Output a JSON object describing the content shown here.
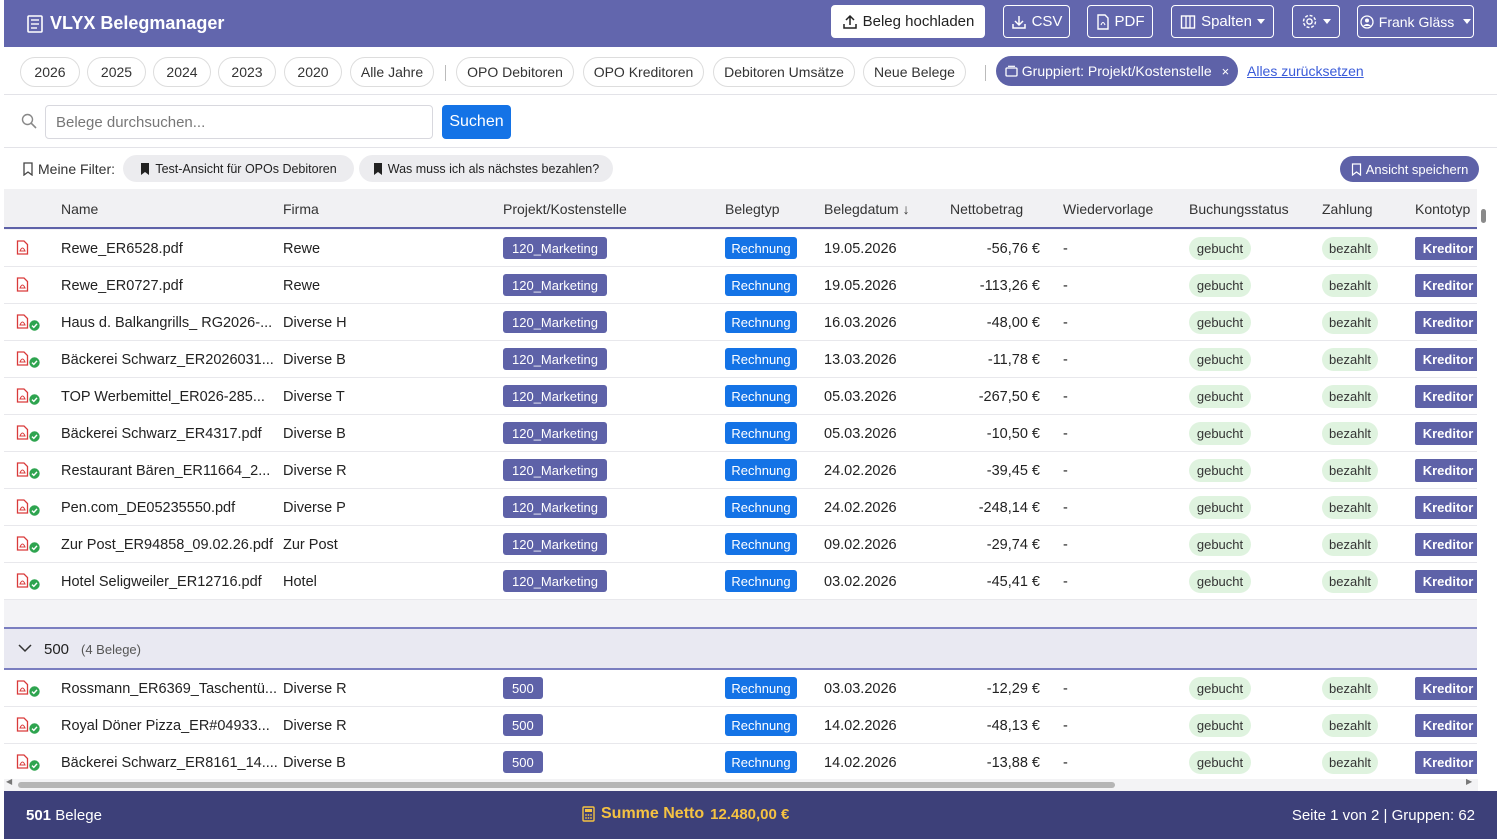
{
  "app": {
    "title": "VLYX Belegmanager"
  },
  "toolbar": {
    "upload": "Beleg hochladen",
    "csv": "CSV",
    "pdf": "PDF",
    "columns": "Spalten",
    "user": "Frank Gläss"
  },
  "chips": {
    "years": [
      "2026",
      "2025",
      "2024",
      "2023",
      "2020",
      "Alle Jahre"
    ],
    "views": [
      "OPO Debitoren",
      "OPO Kreditoren",
      "Debitoren Umsätze",
      "Neue Belege"
    ],
    "grouped": "Gruppiert: Projekt/Kostenstelle",
    "reset": "Alles zurücksetzen"
  },
  "search": {
    "placeholder": "Belege durchsuchen...",
    "button": "Suchen"
  },
  "filters": {
    "label": "Meine Filter:",
    "saved": [
      "Test-Ansicht für OPOs Debitoren",
      "Was muss ich als nächstes bezahlen?"
    ],
    "save_view": "Ansicht speichern"
  },
  "table": {
    "columns": [
      "Name",
      "Firma",
      "Projekt/Kostenstelle",
      "Belegtyp",
      "Belegdatum ↓",
      "Nettobetrag",
      "Wiedervorlage",
      "Buchungsstatus",
      "Zahlung",
      "Kontotyp"
    ],
    "rows": [
      {
        "name": "Rewe_ER6528.pdf",
        "firma": "Rewe",
        "projekt": "120_Marketing",
        "typ": "Rechnung",
        "datum": "19.05.2026",
        "netto": "-56,76 €",
        "wv": "-",
        "status": "gebucht",
        "zahlung": "bezahlt",
        "konto": "Kreditor",
        "ok": false
      },
      {
        "name": "Rewe_ER0727.pdf",
        "firma": "Rewe",
        "projekt": "120_Marketing",
        "typ": "Rechnung",
        "datum": "19.05.2026",
        "netto": "-113,26 €",
        "wv": "-",
        "status": "gebucht",
        "zahlung": "bezahlt",
        "konto": "Kreditor",
        "ok": false
      },
      {
        "name": "Haus d. Balkangrills_ RG2026-...",
        "firma": "Diverse H",
        "projekt": "120_Marketing",
        "typ": "Rechnung",
        "datum": "16.03.2026",
        "netto": "-48,00 €",
        "wv": "-",
        "status": "gebucht",
        "zahlung": "bezahlt",
        "konto": "Kreditor",
        "ok": true
      },
      {
        "name": "Bäckerei Schwarz_ER2026031...",
        "firma": "Diverse B",
        "projekt": "120_Marketing",
        "typ": "Rechnung",
        "datum": "13.03.2026",
        "netto": "-11,78 €",
        "wv": "-",
        "status": "gebucht",
        "zahlung": "bezahlt",
        "konto": "Kreditor",
        "ok": true
      },
      {
        "name": "TOP Werbemittel_ER026-285...",
        "firma": "Diverse T",
        "projekt": "120_Marketing",
        "typ": "Rechnung",
        "datum": "05.03.2026",
        "netto": "-267,50 €",
        "wv": "-",
        "status": "gebucht",
        "zahlung": "bezahlt",
        "konto": "Kreditor",
        "ok": true
      },
      {
        "name": "Bäckerei Schwarz_ER4317.pdf",
        "firma": "Diverse B",
        "projekt": "120_Marketing",
        "typ": "Rechnung",
        "datum": "05.03.2026",
        "netto": "-10,50 €",
        "wv": "-",
        "status": "gebucht",
        "zahlung": "bezahlt",
        "konto": "Kreditor",
        "ok": true
      },
      {
        "name": "Restaurant Bären_ER11664_2...",
        "firma": "Diverse R",
        "projekt": "120_Marketing",
        "typ": "Rechnung",
        "datum": "24.02.2026",
        "netto": "-39,45 €",
        "wv": "-",
        "status": "gebucht",
        "zahlung": "bezahlt",
        "konto": "Kreditor",
        "ok": true
      },
      {
        "name": "Pen.com_DE05235550.pdf",
        "firma": "Diverse P",
        "projekt": "120_Marketing",
        "typ": "Rechnung",
        "datum": "24.02.2026",
        "netto": "-248,14 €",
        "wv": "-",
        "status": "gebucht",
        "zahlung": "bezahlt",
        "konto": "Kreditor",
        "ok": true
      },
      {
        "name": "Zur Post_ER94858_09.02.26.pdf",
        "firma": "Zur Post",
        "projekt": "120_Marketing",
        "typ": "Rechnung",
        "datum": "09.02.2026",
        "netto": "-29,74 €",
        "wv": "-",
        "status": "gebucht",
        "zahlung": "bezahlt",
        "konto": "Kreditor",
        "ok": true
      },
      {
        "name": "Hotel Seligweiler_ER12716.pdf",
        "firma": "Hotel",
        "projekt": "120_Marketing",
        "typ": "Rechnung",
        "datum": "03.02.2026",
        "netto": "-45,41 €",
        "wv": "-",
        "status": "gebucht",
        "zahlung": "bezahlt",
        "konto": "Kreditor",
        "ok": true
      }
    ],
    "group": {
      "title": "500",
      "count": "(4 Belege)"
    },
    "group_rows": [
      {
        "name": "Rossmann_ER6369_Taschentü...",
        "firma": "Diverse R",
        "projekt": "500",
        "typ": "Rechnung",
        "datum": "03.03.2026",
        "netto": "-12,29 €",
        "wv": "-",
        "status": "gebucht",
        "zahlung": "bezahlt",
        "konto": "Kreditor",
        "ok": true
      },
      {
        "name": "Royal Döner Pizza_ER#04933...",
        "firma": "Diverse R",
        "projekt": "500",
        "typ": "Rechnung",
        "datum": "14.02.2026",
        "netto": "-48,13 €",
        "wv": "-",
        "status": "gebucht",
        "zahlung": "bezahlt",
        "konto": "Kreditor",
        "ok": true
      },
      {
        "name": "Bäckerei Schwarz_ER8161_14....",
        "firma": "Diverse B",
        "projekt": "500",
        "typ": "Rechnung",
        "datum": "14.02.2026",
        "netto": "-13,88 €",
        "wv": "-",
        "status": "gebucht",
        "zahlung": "bezahlt",
        "konto": "Kreditor",
        "ok": true
      }
    ]
  },
  "footer": {
    "count_num": "501",
    "count_label": "Belege",
    "sum_label": "Summe Netto",
    "sum_value": "12.480,00 €",
    "page_info": "Seite 1 von 2 | Gruppen: 62"
  },
  "colors": {
    "primary": "#6266ad",
    "footer": "#3d4079",
    "blue": "#1473e6",
    "sum": "#f5c242"
  }
}
